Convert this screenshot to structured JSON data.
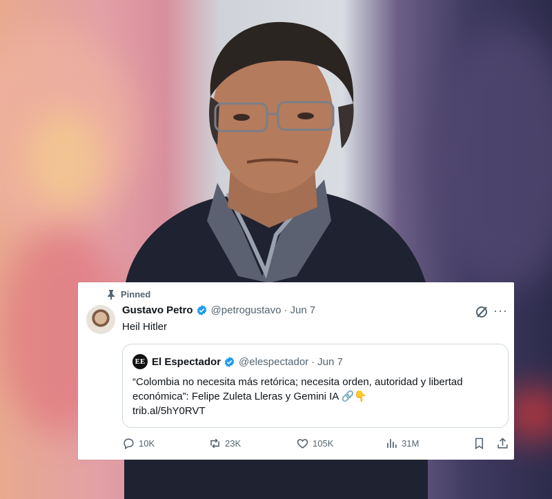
{
  "pinned_label": "Pinned",
  "tweet": {
    "author_name": "Gustavo Petro",
    "author_handle": "@petrogustavo",
    "separator": "·",
    "date": "Jun 7",
    "text": "Heil Hitler",
    "more_label": "···"
  },
  "quote": {
    "logo_text": "EE",
    "author_name": "El Espectador",
    "author_handle": "@elespectador",
    "separator": "·",
    "date": "Jun 7",
    "text": "“Colombia no necesita más retórica; necesita orden, autoridad y libertad económica”: Felipe Zuleta Lleras y Gemini IA 🔗👇",
    "link": "trib.al/5hY0RVT"
  },
  "actions": {
    "replies": "10K",
    "reposts": "23K",
    "likes": "105K",
    "views": "31M"
  },
  "colors": {
    "verified": "#1d9bf0",
    "muted": "#536471",
    "text": "#0f1419",
    "border": "#cfd9de"
  },
  "icons": [
    "pin-icon",
    "verified-badge-icon",
    "grok-icon",
    "more-icon",
    "reply-icon",
    "repost-icon",
    "like-icon",
    "views-icon",
    "bookmark-icon",
    "share-icon"
  ]
}
